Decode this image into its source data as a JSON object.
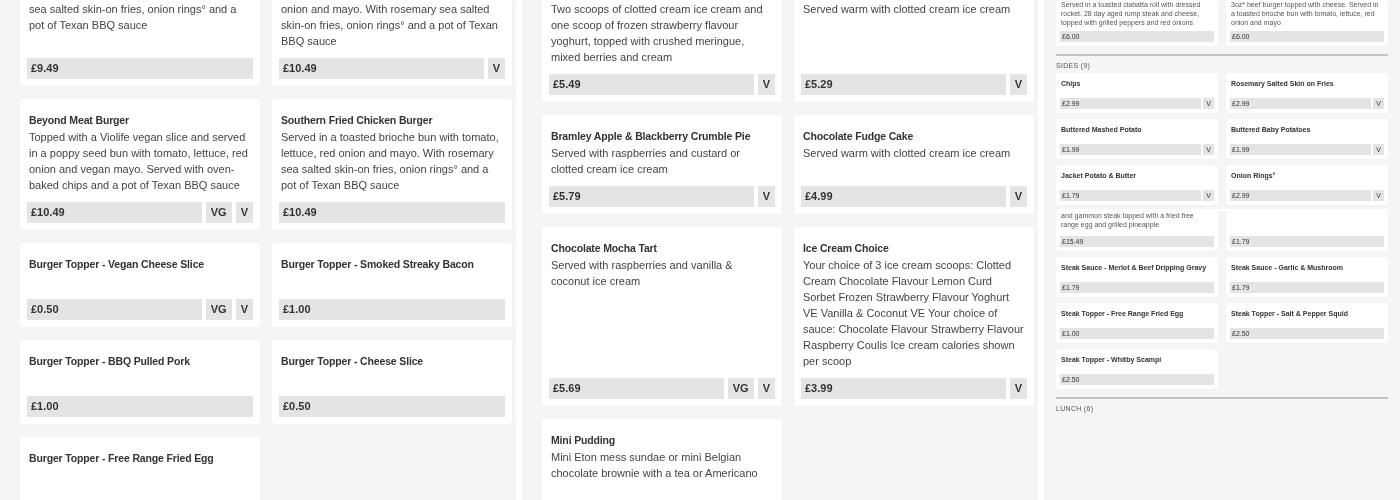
{
  "panels": [
    {
      "kind": "full",
      "views": [
        {
          "sections": [
            {
              "items": [
                {
                  "description": "sea salted skin-on fries, onion rings° and a pot of Texan BBQ sauce",
                  "price": "£9.49"
                },
                {
                  "description": "onion and mayo. With rosemary sea salted skin-on fries, onion rings° and a pot of Texan BBQ sauce",
                  "price": "£10.49",
                  "dietary": [
                    "V"
                  ]
                },
                {
                  "name": "Beyond Meat Burger",
                  "description": "Topped with a Violife vegan slice and served in a poppy seed bun with tomato, lettuce, red onion and vegan mayo. Served with oven-baked chips and a pot of Texan BBQ sauce",
                  "price": "£10.49",
                  "dietary": [
                    "VG",
                    "V"
                  ]
                },
                {
                  "name": "Southern Fried Chicken Burger",
                  "description": "Served in a toasted brioche bun with tomato, lettuce, red onion and mayo. With rosemary sea salted skin-on fries, onion rings° and a pot of Texan BBQ sauce",
                  "price": "£10.49"
                },
                {
                  "name": "Burger Topper - Vegan Cheese Slice",
                  "price": "£0.50",
                  "dietary": [
                    "VG",
                    "V"
                  ]
                },
                {
                  "name": "Burger Topper - Smoked Streaky Bacon",
                  "price": "£1.00"
                },
                {
                  "name": "Burger Topper - BBQ Pulled Pork",
                  "price": "£1.00"
                },
                {
                  "name": "Burger Topper - Cheese Slice",
                  "price": "£0.50"
                },
                {
                  "name": "Burger Topper - Free Range Fried Egg"
                }
              ]
            }
          ]
        }
      ]
    },
    {
      "kind": "full",
      "views": [
        {
          "sections": [
            {
              "items": [
                {
                  "description": "Two scoops of clotted cream ice cream and one scoop of frozen strawberry flavour yoghurt, topped with crushed meringue, mixed berries and cream",
                  "price": "£5.49",
                  "dietary": [
                    "V"
                  ]
                },
                {
                  "description": "Served warm with clotted cream ice cream",
                  "price": "£5.29",
                  "dietary": [
                    "V"
                  ]
                },
                {
                  "name": "Bramley Apple & Blackberry Crumble Pie",
                  "description": "Served with raspberries and custard or clotted cream ice cream",
                  "price": "£5.79",
                  "dietary": [
                    "V"
                  ]
                },
                {
                  "name": "Chocolate Fudge Cake",
                  "description": "Served warm with clotted cream ice cream",
                  "price": "£4.99",
                  "dietary": [
                    "V"
                  ]
                },
                {
                  "name": "Chocolate Mocha Tart",
                  "description": "Served with raspberries and vanilla & coconut ice cream",
                  "price": "£5.69",
                  "dietary": [
                    "VG",
                    "V"
                  ]
                },
                {
                  "name": "Ice Cream Choice",
                  "description": "Your choice of 3 ice cream scoops: Clotted Cream Chocolate Flavour Lemon Curd Sorbet Frozen Strawberry Flavour Yoghurt VE Vanilla & Coconut VE Your choice of sauce: Chocolate Flavour Strawberry Flavour Raspberry Coulis Ice cream calories shown per scoop",
                  "price": "£3.99",
                  "dietary": [
                    "V"
                  ]
                },
                {
                  "name": "Mini Pudding",
                  "description": "Mini Eton mess sundae or mini Belgian chocolate brownie with a tea or Americano"
                }
              ]
            }
          ]
        }
      ]
    },
    {
      "kind": "compact",
      "views": [
        {
          "sections": [
            {
              "items": [
                {
                  "description": "Served in a toasted ciabatta roll with dressed rocket. 28 day aged rump steak and cheese, topped with grilled peppers and red onions",
                  "price": "£6.00"
                },
                {
                  "description": "3oz* beef burger topped with cheese. Served in a toasted brioche bun with tomato, lettuce, red onion and mayo",
                  "price": "£6.00"
                }
              ]
            },
            {
              "heading": "SIDES (9)",
              "items": [
                {
                  "name": "Chips",
                  "price": "£2.99",
                  "dietary": [
                    "V"
                  ]
                },
                {
                  "name": "Rosemary Salted Skin on Fries",
                  "price": "£2.99",
                  "dietary": [
                    "V"
                  ]
                },
                {
                  "name": "Buttered Mashed Potato",
                  "price": "£1.99",
                  "dietary": [
                    "V"
                  ]
                },
                {
                  "name": "Buttered Baby Potatoes",
                  "price": "£1.99",
                  "dietary": [
                    "V"
                  ]
                },
                {
                  "name": "Jacket Potato & Butter",
                  "price": "£1.79",
                  "dietary": [
                    "V"
                  ]
                },
                {
                  "name": "Onion Rings°",
                  "price": "£2.99",
                  "dietary": [
                    "V"
                  ]
                }
              ]
            }
          ]
        },
        {
          "sections": [
            {
              "items": [
                {
                  "description": "and gammon steak topped with a fried free range egg and grilled pineapple",
                  "price": "£15.49"
                },
                {
                  "price": "£1.79"
                },
                {
                  "name": "Steak Sauce - Merlot & Beef Dripping Gravy",
                  "price": "£1.79"
                },
                {
                  "name": "Steak Sauce - Garlic & Mushroom",
                  "price": "£1.79"
                },
                {
                  "name": "Steak Topper - Free Range Fried Egg",
                  "price": "£1.00"
                },
                {
                  "name": "Steak Topper - Salt & Pepper Squid",
                  "price": "£2.50"
                },
                {
                  "name": "Steak Topper - Whitby Scampi",
                  "price": "£2.50"
                }
              ]
            },
            {
              "heading": "LUNCH (6)"
            }
          ]
        }
      ]
    }
  ]
}
